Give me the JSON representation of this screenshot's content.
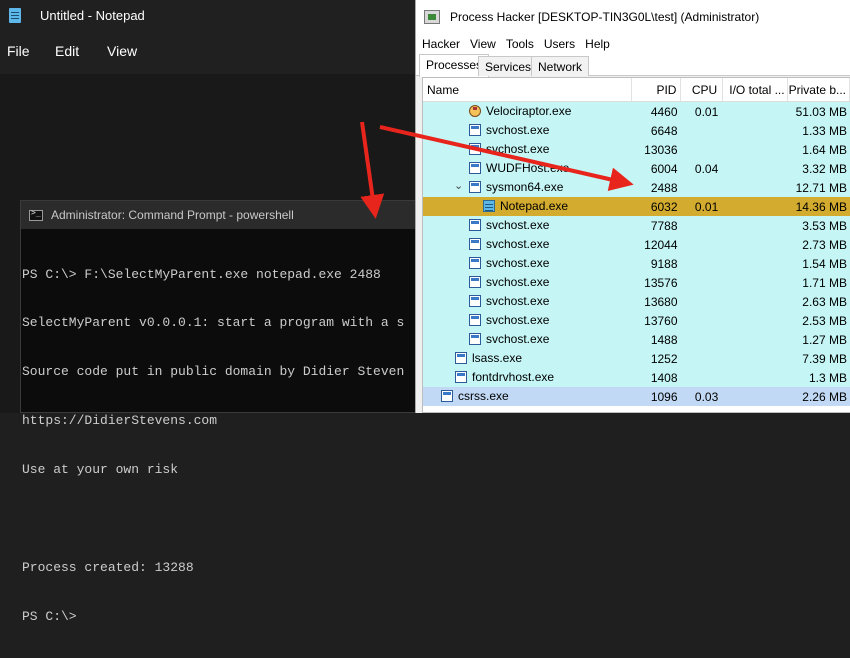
{
  "notepad": {
    "title": "Untitled - Notepad",
    "menu": [
      "File",
      "Edit",
      "View"
    ]
  },
  "cmd": {
    "title": "Administrator: Command Prompt - powershell",
    "lines": [
      "PS C:\\> F:\\SelectMyParent.exe notepad.exe 2488",
      "SelectMyParent v0.0.0.1: start a program with a s",
      "Source code put in public domain by Didier Steven",
      "https://DidierStevens.com",
      "Use at your own risk",
      "",
      "Process created: 13288",
      "PS C:\\>"
    ]
  },
  "processhacker": {
    "title": "Process Hacker [DESKTOP-TIN3G0L\\test] (Administrator)",
    "menu": [
      "Hacker",
      "View",
      "Tools",
      "Users",
      "Help"
    ],
    "tabs": [
      "Processes",
      "Services",
      "Network"
    ],
    "active_tab": "Processes",
    "columns": [
      "Name",
      "PID",
      "CPU",
      "I/O total ...",
      "Private b..."
    ],
    "rows": [
      {
        "name": "Velociraptor.exe",
        "pid": "4460",
        "cpu": "0.01",
        "io": "",
        "priv": "51.03 MB",
        "indent": 2,
        "icon": "velo",
        "color": "#c5f5f5"
      },
      {
        "name": "svchost.exe",
        "pid": "6648",
        "cpu": "",
        "io": "",
        "priv": "1.33 MB",
        "indent": 2,
        "icon": "svc",
        "color": "#c5f5f5"
      },
      {
        "name": "svchost.exe",
        "pid": "13036",
        "cpu": "",
        "io": "",
        "priv": "1.64 MB",
        "indent": 2,
        "icon": "svc",
        "color": "#c5f5f5"
      },
      {
        "name": "WUDFHost.exe",
        "pid": "6004",
        "cpu": "0.04",
        "io": "",
        "priv": "3.32 MB",
        "indent": 2,
        "icon": "svc",
        "color": "#c5f5f5"
      },
      {
        "name": "sysmon64.exe",
        "pid": "2488",
        "cpu": "",
        "io": "",
        "priv": "12.71 MB",
        "indent": 2,
        "icon": "svc",
        "color": "#c5f5f5",
        "expanded": true
      },
      {
        "name": "Notepad.exe",
        "pid": "6032",
        "cpu": "0.01",
        "io": "",
        "priv": "14.36 MB",
        "indent": 3,
        "icon": "notepad",
        "color": "#d2ab2f"
      },
      {
        "name": "svchost.exe",
        "pid": "7788",
        "cpu": "",
        "io": "",
        "priv": "3.53 MB",
        "indent": 2,
        "icon": "svc",
        "color": "#c5f5f5"
      },
      {
        "name": "svchost.exe",
        "pid": "12044",
        "cpu": "",
        "io": "",
        "priv": "2.73 MB",
        "indent": 2,
        "icon": "svc",
        "color": "#c5f5f5"
      },
      {
        "name": "svchost.exe",
        "pid": "9188",
        "cpu": "",
        "io": "",
        "priv": "1.54 MB",
        "indent": 2,
        "icon": "svc",
        "color": "#c5f5f5"
      },
      {
        "name": "svchost.exe",
        "pid": "13576",
        "cpu": "",
        "io": "",
        "priv": "1.71 MB",
        "indent": 2,
        "icon": "svc",
        "color": "#c5f5f5"
      },
      {
        "name": "svchost.exe",
        "pid": "13680",
        "cpu": "",
        "io": "",
        "priv": "2.63 MB",
        "indent": 2,
        "icon": "svc",
        "color": "#c5f5f5"
      },
      {
        "name": "svchost.exe",
        "pid": "13760",
        "cpu": "",
        "io": "",
        "priv": "2.53 MB",
        "indent": 2,
        "icon": "svc",
        "color": "#c5f5f5"
      },
      {
        "name": "svchost.exe",
        "pid": "1488",
        "cpu": "",
        "io": "",
        "priv": "1.27 MB",
        "indent": 2,
        "icon": "svc",
        "color": "#c5f5f5"
      },
      {
        "name": "lsass.exe",
        "pid": "1252",
        "cpu": "",
        "io": "",
        "priv": "7.39 MB",
        "indent": 1,
        "icon": "svc",
        "color": "#c5f5f5"
      },
      {
        "name": "fontdrvhost.exe",
        "pid": "1408",
        "cpu": "",
        "io": "",
        "priv": "1.3 MB",
        "indent": 1,
        "icon": "svc",
        "color": "#c5f5f5"
      },
      {
        "name": "csrss.exe",
        "pid": "1096",
        "cpu": "0.03",
        "io": "",
        "priv": "2.26 MB",
        "indent": 0,
        "icon": "svc",
        "color": "#c2d9f5"
      }
    ]
  },
  "colors": {
    "arrow": "#e8251c",
    "service_row": "#c5f5f5",
    "highlight_row": "#d2ab2f",
    "system_row": "#c2d9f5"
  }
}
